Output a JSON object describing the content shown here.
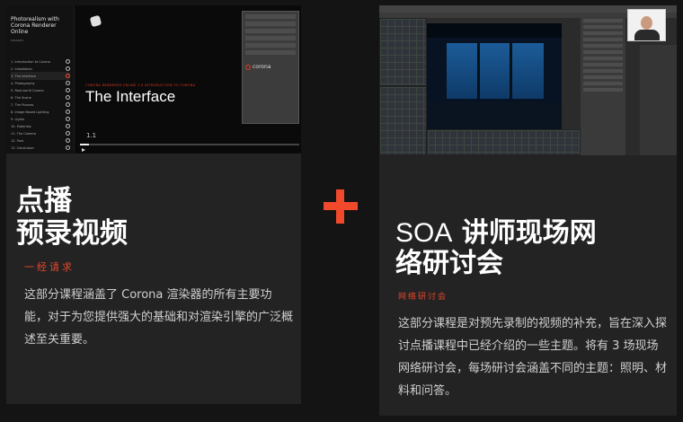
{
  "left_card": {
    "screenshot": {
      "course_title": "Photorealism with Corona Renderer Online",
      "course_subtitle": "Lessons",
      "lessons": [
        "1. Introduction to Corona",
        "2. Installation",
        "3. The Interface",
        "4. Photography",
        "5. Real-world Corona",
        "6. The Scene",
        "7. The Process",
        "8. Image Based Lighting",
        "9. Lights",
        "10. Materials",
        "11. The Camera",
        "12. Post",
        "13. Conclusion"
      ],
      "video_caption_red": "CORONA RENDERER ONLINE 1.3 INTRODUCTION TO CORONA",
      "video_title": "The Interface",
      "video_number": "1.1",
      "progress": 0.04,
      "render_logo_text": "corona"
    },
    "title_line1": "点播",
    "title_line2": "预录视频",
    "tag": "一经请求",
    "description": "这部分课程涵盖了 Corona 渲染器的所有主要功能，对于为您提供强大的基础和对渲染引擎的广泛概述至关重要。"
  },
  "plus_icon": "plus-icon",
  "right_card": {
    "title_latin": "SOA",
    "title_rest_line1": " 讲师现场网",
    "title_line2": "络研讨会",
    "tag": "网络研讨会",
    "description": "这部分课程是对预先录制的视频的补充，旨在深入探讨点播课程中已经介绍的一些主题。将有 3 场现场网络研讨会，每场研讨会涵盖不同的主题：照明、材料和问答。"
  },
  "colors": {
    "accent": "#f0492b",
    "card_bg": "#232323",
    "page_bg": "#141414"
  }
}
